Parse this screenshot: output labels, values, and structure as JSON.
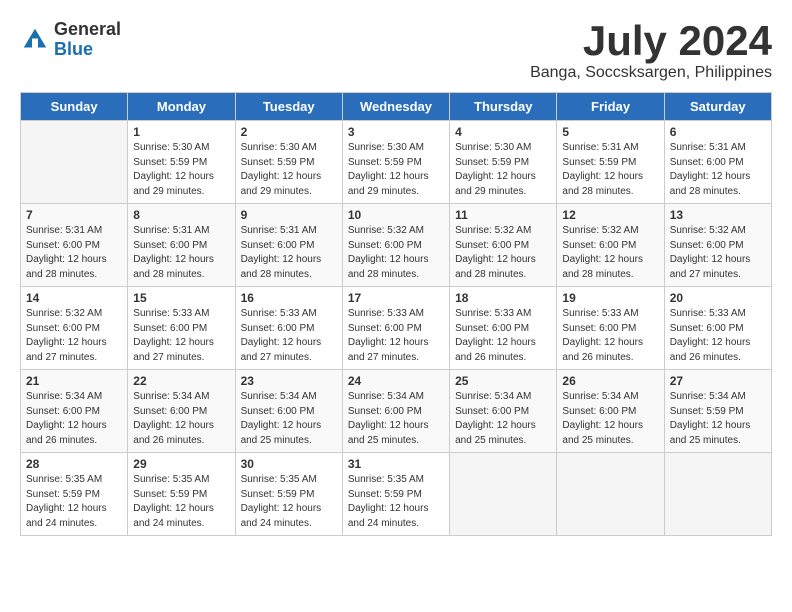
{
  "logo": {
    "general": "General",
    "blue": "Blue"
  },
  "title": {
    "month": "July 2024",
    "location": "Banga, Soccsksargen, Philippines"
  },
  "days_header": [
    "Sunday",
    "Monday",
    "Tuesday",
    "Wednesday",
    "Thursday",
    "Friday",
    "Saturday"
  ],
  "weeks": [
    [
      {
        "num": "",
        "info": ""
      },
      {
        "num": "1",
        "info": "Sunrise: 5:30 AM\nSunset: 5:59 PM\nDaylight: 12 hours\nand 29 minutes."
      },
      {
        "num": "2",
        "info": "Sunrise: 5:30 AM\nSunset: 5:59 PM\nDaylight: 12 hours\nand 29 minutes."
      },
      {
        "num": "3",
        "info": "Sunrise: 5:30 AM\nSunset: 5:59 PM\nDaylight: 12 hours\nand 29 minutes."
      },
      {
        "num": "4",
        "info": "Sunrise: 5:30 AM\nSunset: 5:59 PM\nDaylight: 12 hours\nand 29 minutes."
      },
      {
        "num": "5",
        "info": "Sunrise: 5:31 AM\nSunset: 5:59 PM\nDaylight: 12 hours\nand 28 minutes."
      },
      {
        "num": "6",
        "info": "Sunrise: 5:31 AM\nSunset: 6:00 PM\nDaylight: 12 hours\nand 28 minutes."
      }
    ],
    [
      {
        "num": "7",
        "info": "Sunrise: 5:31 AM\nSunset: 6:00 PM\nDaylight: 12 hours\nand 28 minutes."
      },
      {
        "num": "8",
        "info": "Sunrise: 5:31 AM\nSunset: 6:00 PM\nDaylight: 12 hours\nand 28 minutes."
      },
      {
        "num": "9",
        "info": "Sunrise: 5:31 AM\nSunset: 6:00 PM\nDaylight: 12 hours\nand 28 minutes."
      },
      {
        "num": "10",
        "info": "Sunrise: 5:32 AM\nSunset: 6:00 PM\nDaylight: 12 hours\nand 28 minutes."
      },
      {
        "num": "11",
        "info": "Sunrise: 5:32 AM\nSunset: 6:00 PM\nDaylight: 12 hours\nand 28 minutes."
      },
      {
        "num": "12",
        "info": "Sunrise: 5:32 AM\nSunset: 6:00 PM\nDaylight: 12 hours\nand 28 minutes."
      },
      {
        "num": "13",
        "info": "Sunrise: 5:32 AM\nSunset: 6:00 PM\nDaylight: 12 hours\nand 27 minutes."
      }
    ],
    [
      {
        "num": "14",
        "info": "Sunrise: 5:32 AM\nSunset: 6:00 PM\nDaylight: 12 hours\nand 27 minutes."
      },
      {
        "num": "15",
        "info": "Sunrise: 5:33 AM\nSunset: 6:00 PM\nDaylight: 12 hours\nand 27 minutes."
      },
      {
        "num": "16",
        "info": "Sunrise: 5:33 AM\nSunset: 6:00 PM\nDaylight: 12 hours\nand 27 minutes."
      },
      {
        "num": "17",
        "info": "Sunrise: 5:33 AM\nSunset: 6:00 PM\nDaylight: 12 hours\nand 27 minutes."
      },
      {
        "num": "18",
        "info": "Sunrise: 5:33 AM\nSunset: 6:00 PM\nDaylight: 12 hours\nand 26 minutes."
      },
      {
        "num": "19",
        "info": "Sunrise: 5:33 AM\nSunset: 6:00 PM\nDaylight: 12 hours\nand 26 minutes."
      },
      {
        "num": "20",
        "info": "Sunrise: 5:33 AM\nSunset: 6:00 PM\nDaylight: 12 hours\nand 26 minutes."
      }
    ],
    [
      {
        "num": "21",
        "info": "Sunrise: 5:34 AM\nSunset: 6:00 PM\nDaylight: 12 hours\nand 26 minutes."
      },
      {
        "num": "22",
        "info": "Sunrise: 5:34 AM\nSunset: 6:00 PM\nDaylight: 12 hours\nand 26 minutes."
      },
      {
        "num": "23",
        "info": "Sunrise: 5:34 AM\nSunset: 6:00 PM\nDaylight: 12 hours\nand 25 minutes."
      },
      {
        "num": "24",
        "info": "Sunrise: 5:34 AM\nSunset: 6:00 PM\nDaylight: 12 hours\nand 25 minutes."
      },
      {
        "num": "25",
        "info": "Sunrise: 5:34 AM\nSunset: 6:00 PM\nDaylight: 12 hours\nand 25 minutes."
      },
      {
        "num": "26",
        "info": "Sunrise: 5:34 AM\nSunset: 6:00 PM\nDaylight: 12 hours\nand 25 minutes."
      },
      {
        "num": "27",
        "info": "Sunrise: 5:34 AM\nSunset: 5:59 PM\nDaylight: 12 hours\nand 25 minutes."
      }
    ],
    [
      {
        "num": "28",
        "info": "Sunrise: 5:35 AM\nSunset: 5:59 PM\nDaylight: 12 hours\nand 24 minutes."
      },
      {
        "num": "29",
        "info": "Sunrise: 5:35 AM\nSunset: 5:59 PM\nDaylight: 12 hours\nand 24 minutes."
      },
      {
        "num": "30",
        "info": "Sunrise: 5:35 AM\nSunset: 5:59 PM\nDaylight: 12 hours\nand 24 minutes."
      },
      {
        "num": "31",
        "info": "Sunrise: 5:35 AM\nSunset: 5:59 PM\nDaylight: 12 hours\nand 24 minutes."
      },
      {
        "num": "",
        "info": ""
      },
      {
        "num": "",
        "info": ""
      },
      {
        "num": "",
        "info": ""
      }
    ]
  ]
}
